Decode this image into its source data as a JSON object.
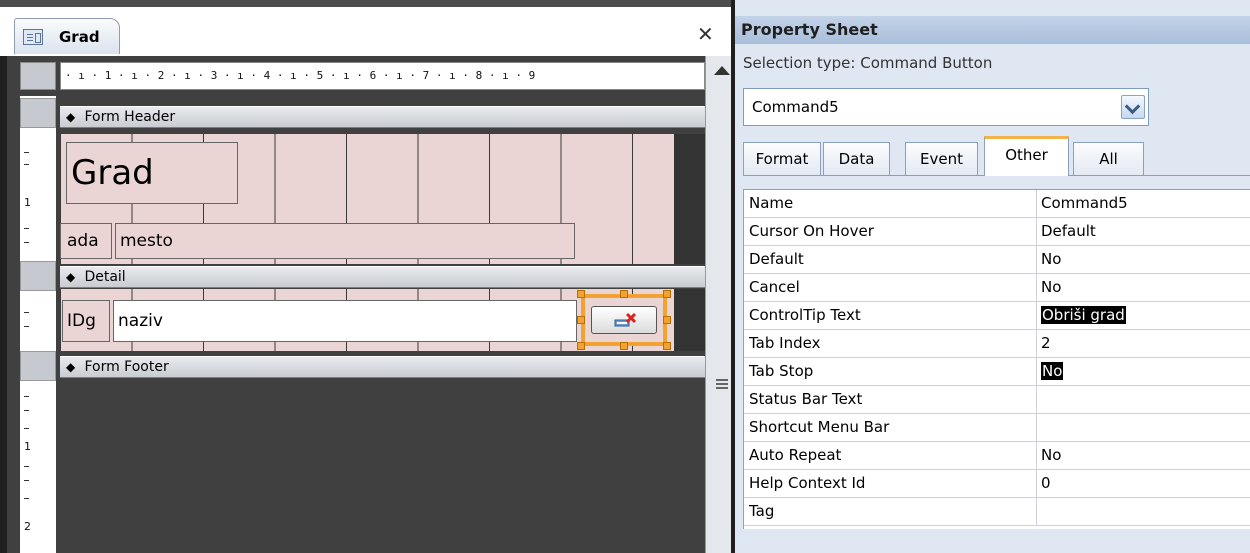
{
  "document": {
    "tab_label": "Grad",
    "close_glyph": "✕",
    "ruler_text": "· ı · 1 · ı · 2 · ı · 3 · ı · 4 · ı · 5 · ı · 6 · ı · 7 · ı · 8 · ı · 9",
    "vertical_ruler_marks": [
      "1",
      "1",
      "2"
    ],
    "sections": {
      "form_header": "Form Header",
      "detail": "Detail",
      "form_footer": "Form Footer"
    },
    "section_arrow": "◆",
    "controls": {
      "title_label": "Grad",
      "label_ada": "ada",
      "label_mesto": "mesto",
      "label_idg": "IDg",
      "textbox_naziv": "naziv"
    }
  },
  "property_sheet": {
    "title": "Property Sheet",
    "selection_type": "Selection type:  Command Button",
    "selected_object": "Command5",
    "tabs": [
      {
        "label": "Format",
        "active": false
      },
      {
        "label": "Data",
        "active": false
      },
      {
        "label": "Event",
        "active": false
      },
      {
        "label": "Other",
        "active": true
      },
      {
        "label": "All",
        "active": false
      }
    ],
    "properties": [
      {
        "name": "Name",
        "value": "Command5",
        "highlight": false
      },
      {
        "name": "Cursor On Hover",
        "value": "Default",
        "highlight": false
      },
      {
        "name": "Default",
        "value": "No",
        "highlight": false
      },
      {
        "name": "Cancel",
        "value": "No",
        "highlight": false
      },
      {
        "name": "ControlTip Text",
        "value": "Obriši grad",
        "highlight": true
      },
      {
        "name": "Tab Index",
        "value": "2",
        "highlight": false
      },
      {
        "name": "Tab Stop",
        "value": "No",
        "highlight": true
      },
      {
        "name": "Status Bar Text",
        "value": "",
        "highlight": false
      },
      {
        "name": "Shortcut Menu Bar",
        "value": "",
        "highlight": false
      },
      {
        "name": "Auto Repeat",
        "value": "No",
        "highlight": false
      },
      {
        "name": "Help Context Id",
        "value": "0",
        "highlight": false
      },
      {
        "name": "Tag",
        "value": "",
        "highlight": false
      }
    ]
  },
  "colors": {
    "selection_handle": "#f2a230",
    "active_tab_accent": "#f3b34a",
    "design_grid": "#ead4d4",
    "property_highlight": "#000000"
  }
}
